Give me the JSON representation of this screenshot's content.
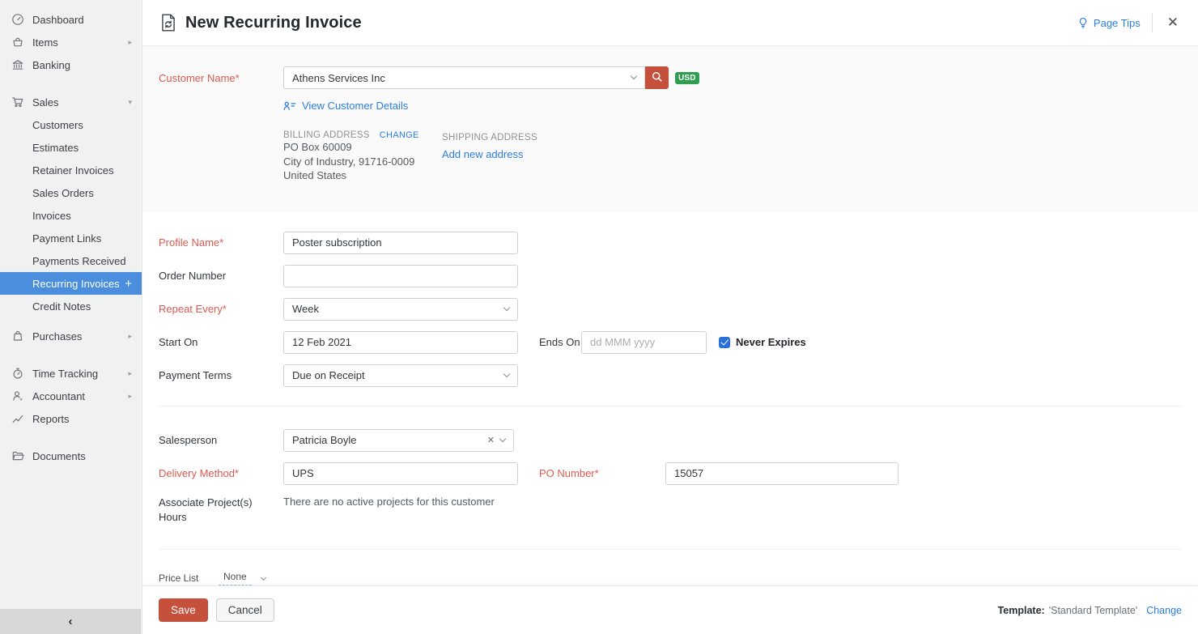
{
  "icons": {
    "chevron_right": "▸",
    "chevron_down": "▾",
    "plus": "+",
    "close": "✕",
    "clear": "✕",
    "collapse": "‹"
  },
  "sidebar": {
    "items": [
      {
        "label": "Dashboard"
      },
      {
        "label": "Items"
      },
      {
        "label": "Banking"
      },
      {
        "label": "Sales"
      },
      {
        "label": "Purchases"
      },
      {
        "label": "Time Tracking"
      },
      {
        "label": "Accountant"
      },
      {
        "label": "Reports"
      },
      {
        "label": "Documents"
      }
    ],
    "sales_submenu": [
      {
        "label": "Customers"
      },
      {
        "label": "Estimates"
      },
      {
        "label": "Retainer Invoices"
      },
      {
        "label": "Sales Orders"
      },
      {
        "label": "Invoices"
      },
      {
        "label": "Payment Links"
      },
      {
        "label": "Payments Received"
      },
      {
        "label": "Recurring Invoices",
        "active": true
      },
      {
        "label": "Credit Notes"
      }
    ]
  },
  "header": {
    "title": "New Recurring Invoice",
    "page_tips": "Page Tips"
  },
  "customer": {
    "name_label": "Customer Name*",
    "name_value": "Athens Services Inc",
    "currency_badge": "USD",
    "view_details_link": "View Customer Details",
    "billing": {
      "title": "BILLING ADDRESS",
      "change_link": "CHANGE",
      "lines": [
        "PO Box 60009",
        "City of Industry, 91716-0009",
        "United States"
      ]
    },
    "shipping": {
      "title": "SHIPPING ADDRESS",
      "add_link": "Add new address"
    }
  },
  "form": {
    "profile_name": {
      "label": "Profile Name*",
      "value": "Poster subscription"
    },
    "order_number": {
      "label": "Order Number",
      "value": ""
    },
    "repeat_every": {
      "label": "Repeat Every*",
      "value": "Week"
    },
    "start_on": {
      "label": "Start On",
      "value": "12 Feb 2021"
    },
    "ends_on": {
      "label": "Ends On",
      "placeholder": "dd MMM yyyy"
    },
    "never_expires": {
      "label": "Never Expires",
      "checked": true
    },
    "payment_terms": {
      "label": "Payment Terms",
      "value": "Due on Receipt"
    },
    "salesperson": {
      "label": "Salesperson",
      "value": "Patricia Boyle"
    },
    "delivery_method": {
      "label": "Delivery Method*",
      "value": "UPS"
    },
    "po_number": {
      "label": "PO Number*",
      "value": "15057"
    },
    "associate_projects": {
      "label_line1": "Associate Project(s)",
      "label_line2": "Hours",
      "note": "There are no active projects for this customer"
    },
    "price_list": {
      "label": "Price List",
      "value": "None"
    }
  },
  "footer": {
    "save_label": "Save",
    "cancel_label": "Cancel",
    "template_label": "Template:",
    "template_value": "'Standard Template'",
    "change_link": "Change"
  },
  "colors": {
    "accent_red": "#c5503c",
    "badge_green": "#2f9e50",
    "active_blue": "#4a8edd",
    "link_blue": "#2b7de0",
    "required_red": "#dc5a50"
  }
}
